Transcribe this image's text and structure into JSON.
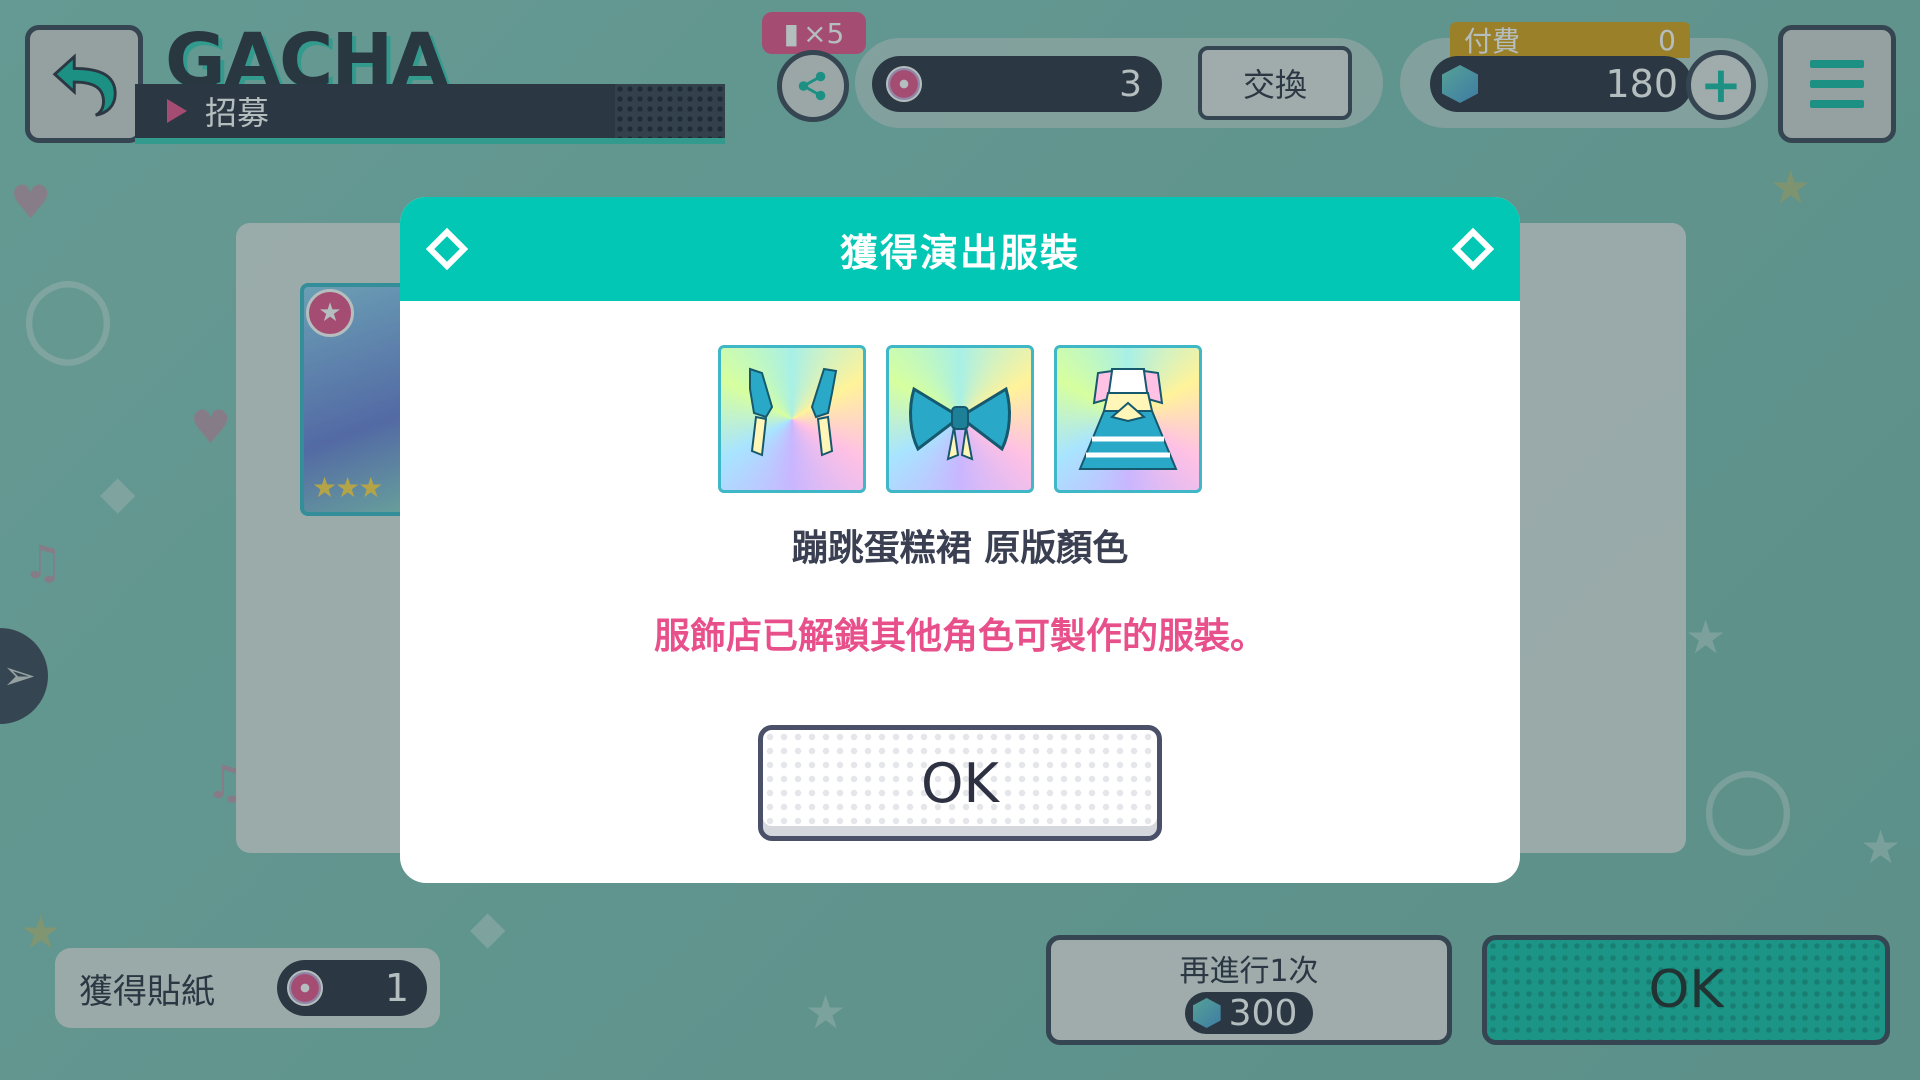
{
  "header": {
    "title": "GACHA",
    "subtitle": "招募",
    "share_badge": "×5",
    "sticker_count": "3",
    "exchange_label": "交換",
    "paid_label": "付費",
    "paid_value": "0",
    "gem_count": "180",
    "plus_label": "+"
  },
  "modal": {
    "title": "獲得演出服裝",
    "items": [
      {
        "icon": "arm-ribbons-icon"
      },
      {
        "icon": "bow-icon"
      },
      {
        "icon": "dress-icon"
      }
    ],
    "costume_name": "蹦跳蛋糕裙 原版顏色",
    "message": "服飾店已解鎖其他角色可製作的服裝。",
    "ok_label": "OK"
  },
  "bottom": {
    "stickers_label": "獲得貼紙",
    "stickers_count": "1",
    "again_label": "再進行1次",
    "again_cost": "300",
    "ok_label": "OK"
  },
  "colors": {
    "accent": "#02c7b4",
    "pink": "#e8508c",
    "dark": "#2d3142"
  }
}
